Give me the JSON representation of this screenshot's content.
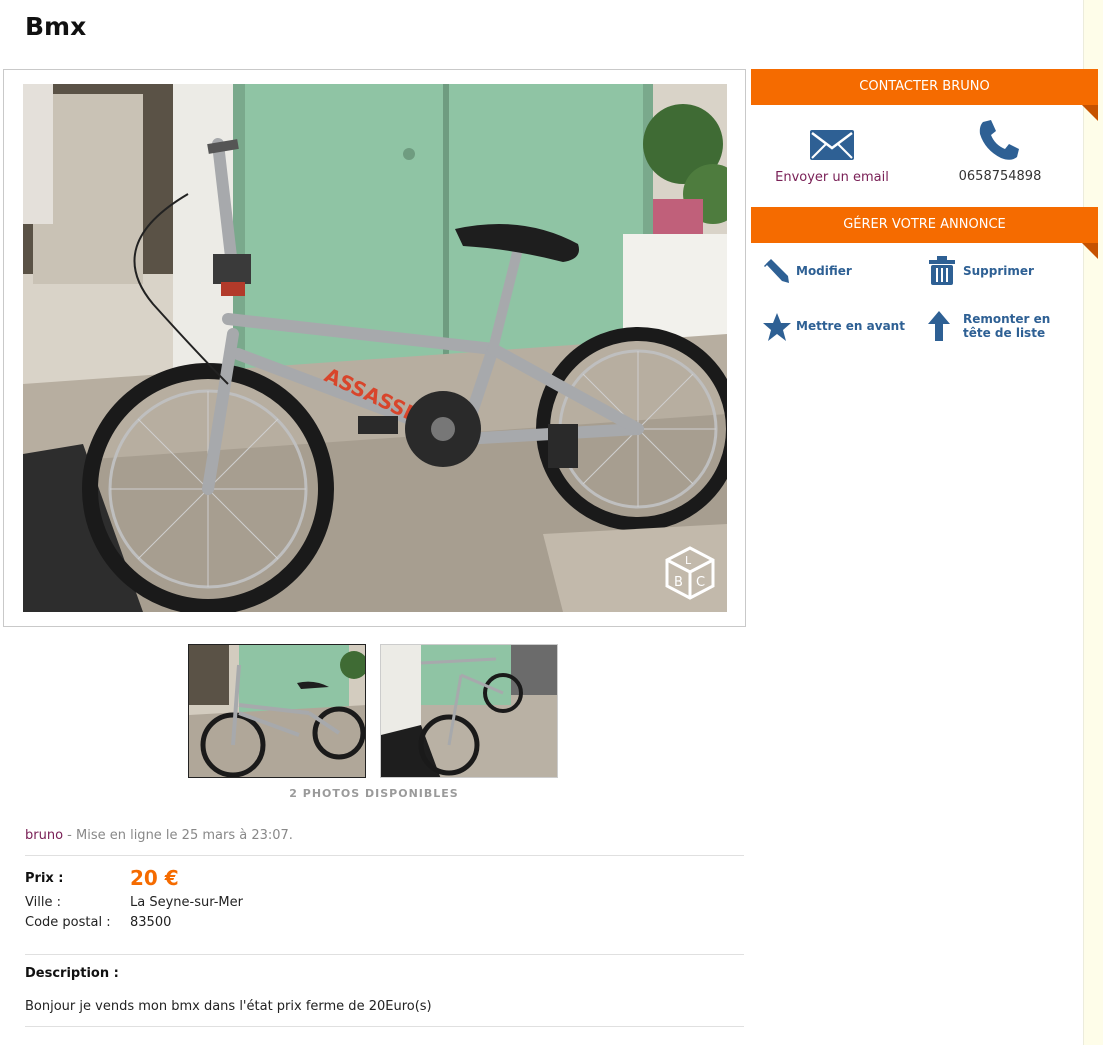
{
  "listing": {
    "title": "Bmx",
    "photos_count_label": "2 PHOTOS DISPONIBLES",
    "seller": "bruno",
    "posted": " - Mise en ligne le 25 mars à 23:07.",
    "price_label": "Prix :",
    "price": "20 €",
    "city_label": "Ville :",
    "city": "La Seyne-sur-Mer",
    "zip_label": "Code postal :",
    "zip": "83500",
    "description_label": "Description :",
    "description": "Bonjour je vends mon bmx dans l'état prix ferme de 20Euro(s)"
  },
  "contact": {
    "header": "CONTACTER BRUNO",
    "email_label": "Envoyer un email",
    "phone": "0658754898"
  },
  "manage": {
    "header": "GÉRER VOTRE ANNONCE",
    "edit": "Modifier",
    "delete": "Supprimer",
    "feature": "Mettre en avant",
    "bump_line1": "Remonter en",
    "bump_line2": "tête de liste"
  },
  "watermark_letters": [
    "L",
    "B",
    "C"
  ],
  "colors": {
    "accent": "#f56b00",
    "seller": "#7a2157",
    "action_blue": "#2e6094",
    "page_strip": "#fefde9"
  },
  "icons": [
    "email-icon",
    "phone-icon",
    "pencil-icon",
    "trash-icon",
    "star-icon",
    "arrow-up-icon",
    "watermark-cube-icon"
  ]
}
